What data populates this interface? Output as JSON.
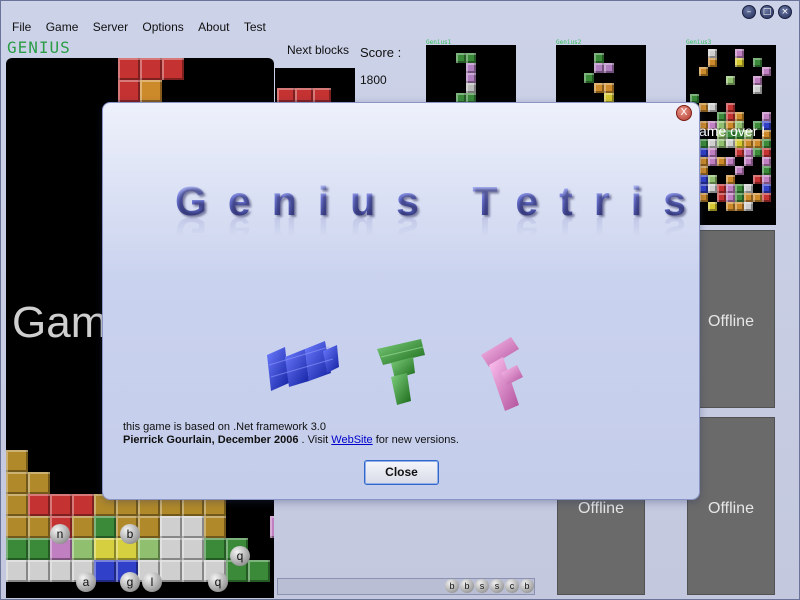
{
  "window": {
    "controls": [
      "minimize-icon",
      "maximize-icon",
      "close-icon"
    ]
  },
  "menu": [
    "File",
    "Game",
    "Server",
    "Options",
    "About",
    "Test"
  ],
  "player": {
    "name": "GENIUS",
    "board_message": "Gam"
  },
  "hud": {
    "next_label": "Next blocks",
    "score_label": "Score :",
    "score_value": "1800"
  },
  "opponents": [
    {
      "label": "Genius1",
      "status": ""
    },
    {
      "label": "Genius2",
      "status": ""
    },
    {
      "label": "Genius3",
      "status": "ame over !"
    }
  ],
  "offline_label": "Offline",
  "board_letters": [
    "n",
    "b",
    "q",
    "a",
    "g",
    "l",
    "q"
  ],
  "special_buttons": [
    "b",
    "b",
    "s",
    "s",
    "c",
    "b"
  ],
  "dialog": {
    "title": "Genius Tetris",
    "credit_line1": "this game is based on .Net framework 3.0",
    "credit_author": "Pierrick Gourlain, December 2006",
    "credit_mid": " . Visit ",
    "credit_link": "WebSite",
    "credit_end": " for new versions.",
    "close_button": "Close",
    "close_icon": "X"
  },
  "colors": {
    "title_blue": "#3a43a0",
    "logo_blue": "#2030c8",
    "logo_green": "#2a8a2a",
    "logo_pink": "#e08ad0",
    "offline_gray": "#6a6a6a",
    "link": "#0000cc"
  }
}
